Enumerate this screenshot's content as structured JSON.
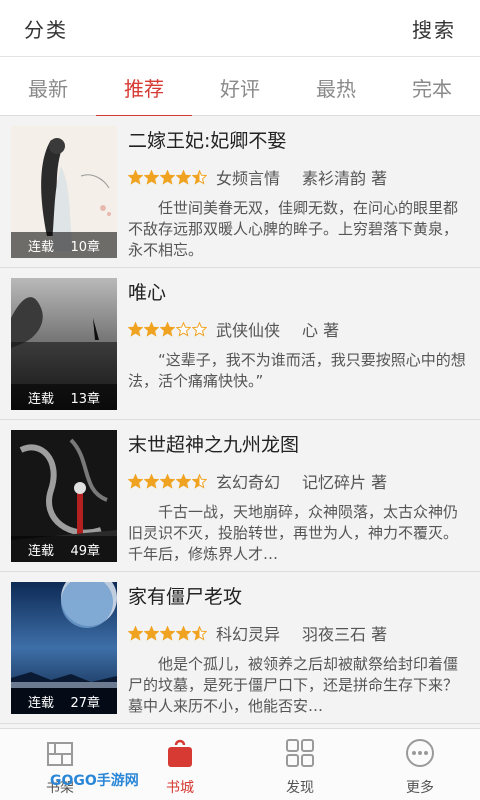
{
  "header": {
    "category_label": "分类",
    "search_label": "搜索"
  },
  "tabs": [
    {
      "label": "最新"
    },
    {
      "label": "推荐"
    },
    {
      "label": "好评"
    },
    {
      "label": "最热"
    },
    {
      "label": "完本"
    }
  ],
  "active_tab": "推荐",
  "books": [
    {
      "title": "二嫁王妃:妃卿不娶",
      "rating": 4.5,
      "genre": "女频言情",
      "author": "素衫清韵 著",
      "status": "连载",
      "chapters": "10章",
      "description": "任世间美眷无双，佳卿无数，在问心的眼里都不敌存远那双暖人心脾的眸子。上穷碧落下黄泉，永不相忘。"
    },
    {
      "title": "唯心",
      "rating": 3,
      "genre": "武侠仙侠",
      "author": "心 著",
      "status": "连载",
      "chapters": "13章",
      "description": "“这辈子，我不为谁而活，我只要按照心中的想法，活个痛痛快快。”"
    },
    {
      "title": "末世超神之九州龙图",
      "rating": 4.5,
      "genre": "玄幻奇幻",
      "author": "记忆碎片 著",
      "status": "连载",
      "chapters": "49章",
      "description": "千古一战，天地崩碎，众神陨落，太古众神仍旧灵识不灭，投胎转世，再世为人，神力不覆灭。　　千年后，修炼界人才…"
    },
    {
      "title": "家有僵尸老攻",
      "rating": 4.5,
      "genre": "科幻灵异",
      "author": "羽夜三石 著",
      "status": "连载",
      "chapters": "27章",
      "description": "他是个孤儿，被领养之后却被献祭给封印着僵尸的坟墓，是死于僵尸口下，还是拼命生存下来？墓中人来历不小，他能否安…"
    }
  ],
  "bottom_nav": [
    {
      "label": "书架",
      "icon": "bookshelf-icon"
    },
    {
      "label": "书城",
      "icon": "bookstore-icon"
    },
    {
      "label": "发现",
      "icon": "grid-icon"
    },
    {
      "label": "更多",
      "icon": "more-icon"
    }
  ],
  "watermark": {
    "text": "GOGO手游网"
  },
  "colors": {
    "accent": "#d63a33",
    "star": "#f0a321"
  }
}
